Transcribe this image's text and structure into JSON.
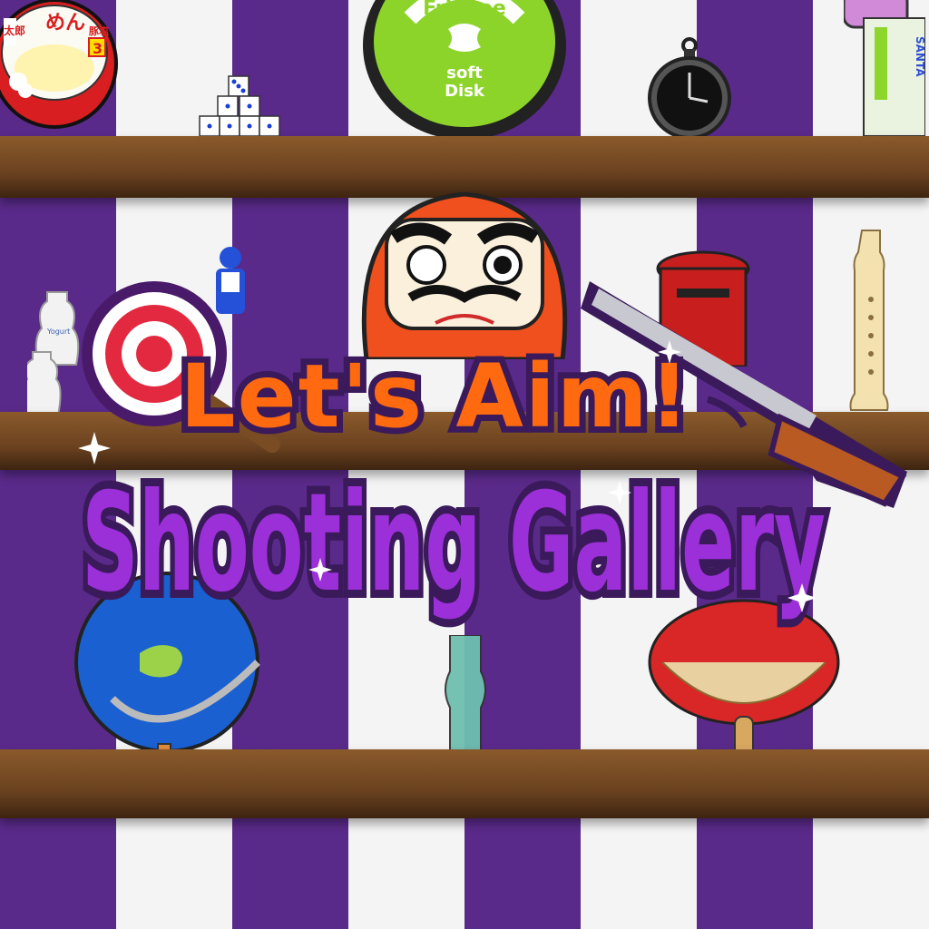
{
  "game": {
    "title_line1": "Let's Aim!",
    "title_line2": "Shooting Gallery"
  },
  "prizes": {
    "noodle_cup": {
      "kanji_top": "めん",
      "kanji_side": "太郎",
      "kanji_right": "豚塩",
      "number": "3"
    },
    "frisbee": {
      "brand": "FrisBee",
      "line1": "soft",
      "line2": "Disk"
    },
    "drink_can": {
      "brand": "SANTA"
    },
    "yogurt_label": "Yogurt"
  },
  "colors": {
    "purple_stripe": "#5c2a8c",
    "white_stripe": "#ffffff",
    "shelf_wood": "#7a4c24",
    "title_orange": "#ff6a10",
    "title_purple": "#9b2fd8",
    "target_red": "#e2293f",
    "frisbee_green": "#8cd42a",
    "daruma_red": "#f0501e"
  },
  "icons": [
    "target-icon",
    "rifle-icon",
    "daruma-icon",
    "globe-icon",
    "fan-icon",
    "pocket-watch-icon",
    "recorder-icon",
    "dice-pyramid-icon",
    "mailbox-icon",
    "robot-figure-icon",
    "ramune-bottle-icon",
    "yogurt-bottle-icon"
  ]
}
